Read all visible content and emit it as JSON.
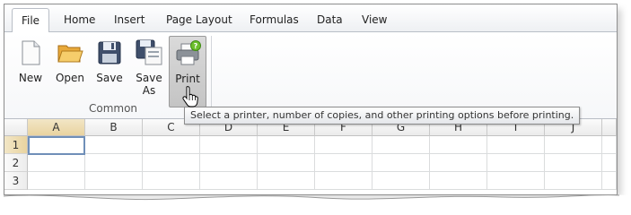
{
  "tabs": [
    {
      "label": "File",
      "active": true
    },
    {
      "label": "Home"
    },
    {
      "label": "Insert"
    },
    {
      "label": "Page Layout"
    },
    {
      "label": "Formulas"
    },
    {
      "label": "Data"
    },
    {
      "label": "View"
    }
  ],
  "ribbon": {
    "buttons": [
      {
        "label": "New",
        "icon": "new-document-icon"
      },
      {
        "label": "Open",
        "icon": "open-folder-icon"
      },
      {
        "label": "Save",
        "icon": "floppy-disk-icon"
      },
      {
        "label": "Save\nAs",
        "icon": "save-as-icon"
      },
      {
        "label": "Print",
        "icon": "printer-icon",
        "pressed": true
      }
    ],
    "group_label": "Common"
  },
  "tooltip": {
    "text": "Select a printer, number of copies, and other printing options before printing."
  },
  "grid": {
    "columns": [
      "A",
      "B",
      "C",
      "D",
      "E",
      "F",
      "G",
      "H",
      "I",
      "J"
    ],
    "rows": [
      "1",
      "2",
      "3"
    ],
    "selected_cell": "A1"
  },
  "colors": {
    "selection_header": "#e9d4a0",
    "active_cell_border": "#6f8fb8"
  }
}
